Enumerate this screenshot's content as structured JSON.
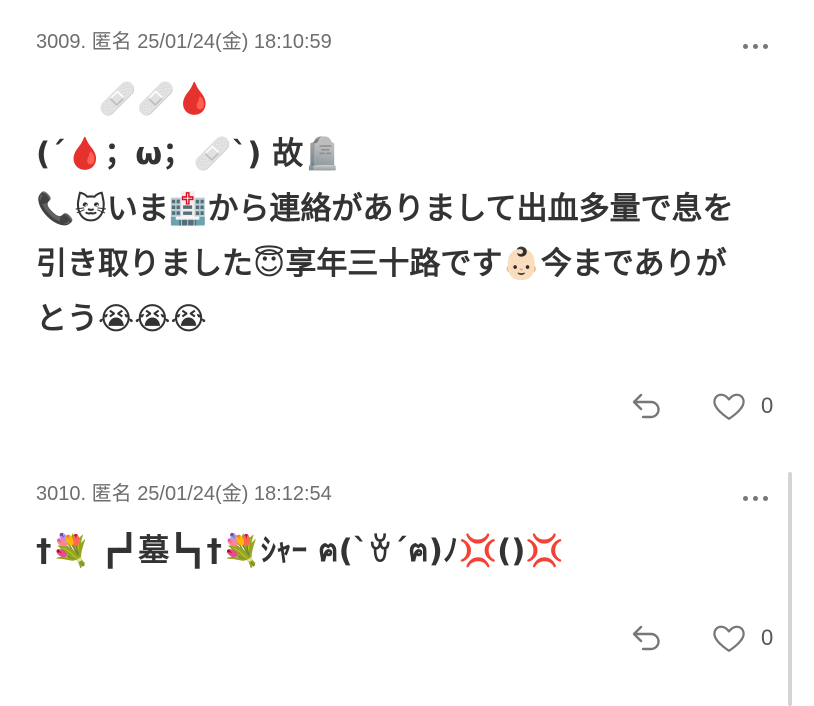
{
  "posts": [
    {
      "number": "3009.",
      "author": "匿名",
      "datetime": "25/01/24(金) 18:10:59",
      "body_lines": [
        "　　🩹🩹🩸",
        "(´🩸；ω；🩹`) 故🪦",
        "📞🐱いま🏥から連絡がありまして出血多量で息を",
        "引き取りました😇享年三十路です👶🏻今までありが",
        "とう😭😭😭"
      ],
      "like_count": "0"
    },
    {
      "number": "3010.",
      "author": "匿名",
      "datetime": "25/01/24(金) 18:12:54",
      "body_lines": [
        "†💐 ┏┛墓┗┓†💐ｼｬｰ ฅ(`ꈊ´ฅ)ﾉ💢()💢"
      ],
      "like_count": "0"
    }
  ],
  "icons": {
    "more": "more-options-icon",
    "reply": "reply-arrow-icon",
    "like": "heart-outline-icon"
  },
  "colors": {
    "meta_text": "#6d6d6d",
    "body_text": "#333333",
    "icon": "#777777",
    "scrollbar": "#d4d4d4"
  }
}
